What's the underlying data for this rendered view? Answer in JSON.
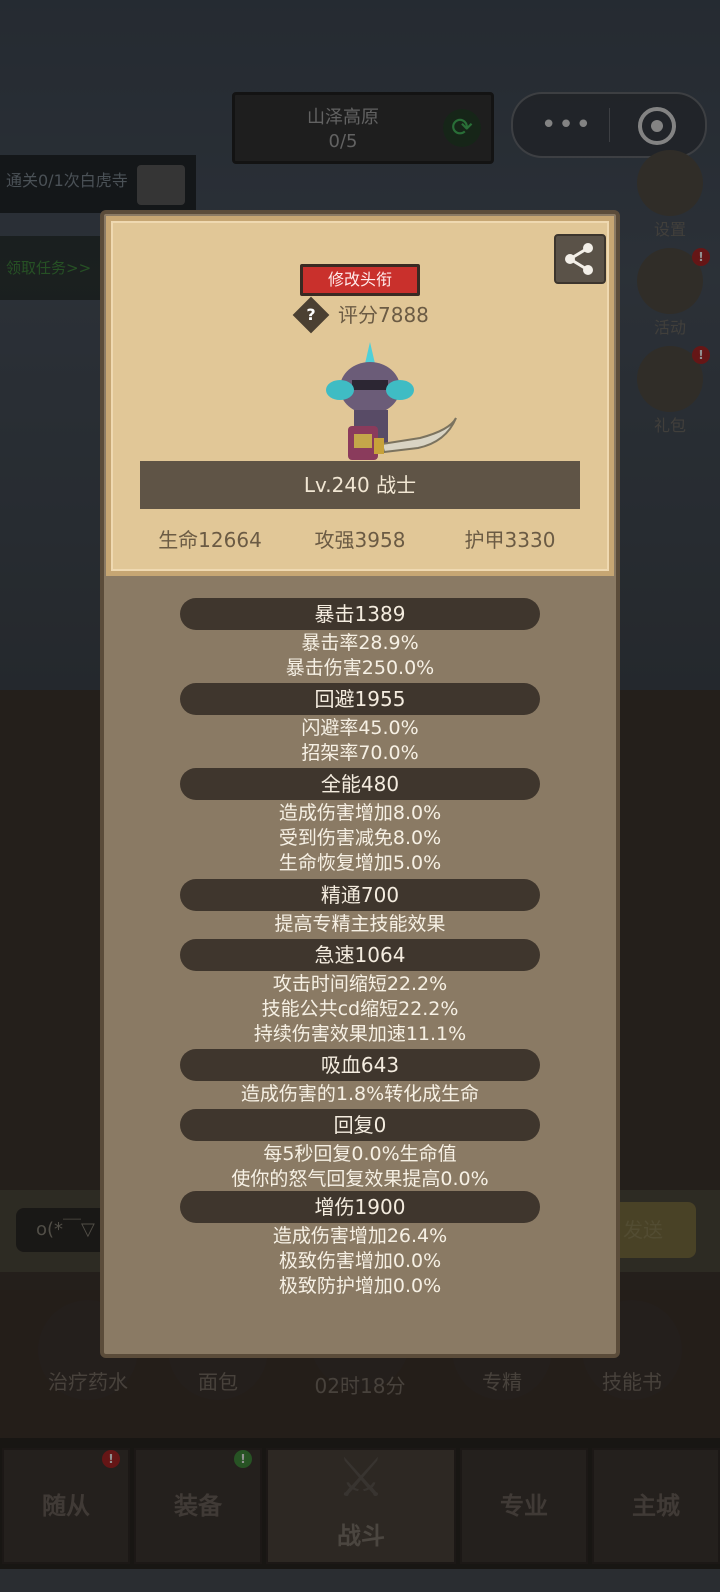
{
  "stage": {
    "name": "山泽高原",
    "progress": "0/5"
  },
  "menu_capsule": {
    "more_icon": "dots-icon",
    "close_icon": "target-icon"
  },
  "quest": {
    "text": "通关0/1次白虎寺",
    "claim": "领取任务>>"
  },
  "side": [
    {
      "label": "设置",
      "icon": "gear-icon"
    },
    {
      "label": "活动",
      "icon": "scroll-icon",
      "badge": "!"
    },
    {
      "label": "礼包",
      "icon": "coin-icon",
      "badge": "!"
    }
  ],
  "panel": {
    "title_button": "修改头衔",
    "score_icon": "?",
    "score": "评分7888",
    "level_class": "Lv.240 战士",
    "stats": [
      "生命12664",
      "攻强3958",
      "护甲3330"
    ],
    "sections": [
      {
        "header": "暴击1389",
        "lines": [
          "暴击率28.9%",
          "暴击伤害250.0%"
        ]
      },
      {
        "header": "回避1955",
        "lines": [
          "闪避率45.0%",
          "招架率70.0%"
        ]
      },
      {
        "header": "全能480",
        "lines": [
          "造成伤害增加8.0%",
          "受到伤害减免8.0%",
          "生命恢复增加5.0%"
        ]
      },
      {
        "header": "精通700",
        "lines": [
          "提高专精主技能效果"
        ]
      },
      {
        "header": "急速1064",
        "lines": [
          "攻击时间缩短22.2%",
          "技能公共cd缩短22.2%",
          "持续伤害效果加速11.1%"
        ]
      },
      {
        "header": "吸血643",
        "lines": [
          "造成伤害的1.8%转化成生命"
        ]
      },
      {
        "header": "回复0",
        "lines": [
          "每5秒回复0.0%生命值",
          "使你的怒气回复效果提高0.0%"
        ]
      },
      {
        "header": "增伤1900",
        "lines": [
          "造成伤害增加26.4%",
          "极致伤害增加0.0%",
          "极致防护增加0.0%"
        ]
      }
    ]
  },
  "chat": {
    "input_text": "o(*￣▽",
    "send": "发送"
  },
  "consumables": [
    "治疗药水",
    "面包",
    "",
    "专精",
    "技能书"
  ],
  "timer": "02时18分",
  "nav": {
    "tabs": [
      "随从",
      "装备",
      "战斗",
      "专业",
      "主城"
    ],
    "badges": [
      "!",
      "!"
    ]
  },
  "colors": {
    "title_button": "#c9302c",
    "card_bg": "#e1c797",
    "panel_bg": "#8a7a64",
    "section_bg": "#3f362d"
  }
}
